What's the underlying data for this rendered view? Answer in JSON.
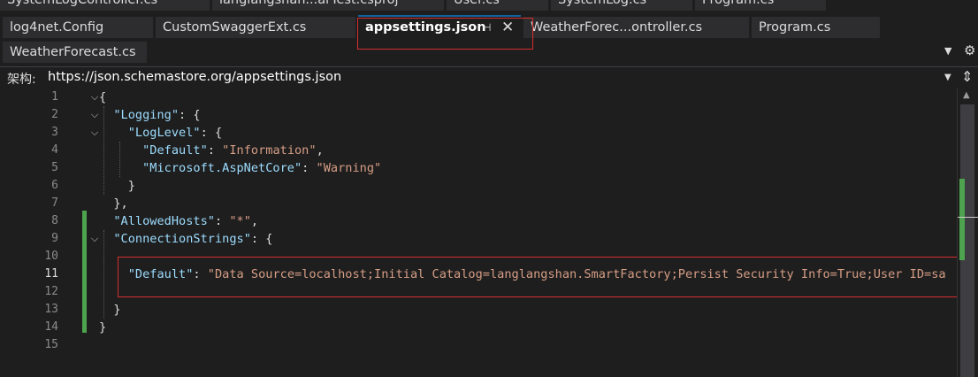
{
  "tabs_row1": [
    {
      "label": "SystemLogController.cs"
    },
    {
      "label": "langlangshan...arTest.csproj"
    },
    {
      "label": "User.cs"
    },
    {
      "label": "SystemLog.cs"
    },
    {
      "label": "Program.cs"
    }
  ],
  "tabs_row2": [
    {
      "label": "log4net.Config"
    },
    {
      "label": "CustomSwaggerExt.cs"
    },
    {
      "label": "appsettings.json",
      "active": true
    },
    {
      "label": "WeatherForec...ontroller.cs"
    },
    {
      "label": "Program.cs"
    }
  ],
  "tabs_row3": [
    {
      "label": "WeatherForecast.cs"
    }
  ],
  "tab_icons": {
    "pin": "pin-icon",
    "close": "close-icon",
    "dropdown": "chevron-down-icon",
    "settings": "gear-icon"
  },
  "schema": {
    "label": "架构:",
    "url": "https://json.schemastore.org/appsettings.json"
  },
  "editor": {
    "current_line": 11,
    "line_numbers": [
      "1",
      "2",
      "3",
      "4",
      "5",
      "6",
      "7",
      "8",
      "9",
      "10",
      "11",
      "12",
      "13",
      "14",
      "15"
    ],
    "lines": [
      "{",
      "  \"Logging\": {",
      "    \"LogLevel\": {",
      "      \"Default\": \"Information\",",
      "      \"Microsoft.AspNetCore\": \"Warning\"",
      "    }",
      "  },",
      "  \"AllowedHosts\": \"*\",",
      "  \"ConnectionStrings\": {",
      "",
      "    \"Default\": \"Data Source=localhost;Initial Catalog=langlangshan.SmartFactory;Persist Security Info=True;User ID=sa;Pa",
      "",
      "  }",
      "}",
      ""
    ]
  },
  "colors": {
    "background": "#1e1e1e",
    "key": "#9cdcfe",
    "string": "#d69d85",
    "highlight_box": "#d62d2d",
    "change_bar": "#4ea44e"
  }
}
